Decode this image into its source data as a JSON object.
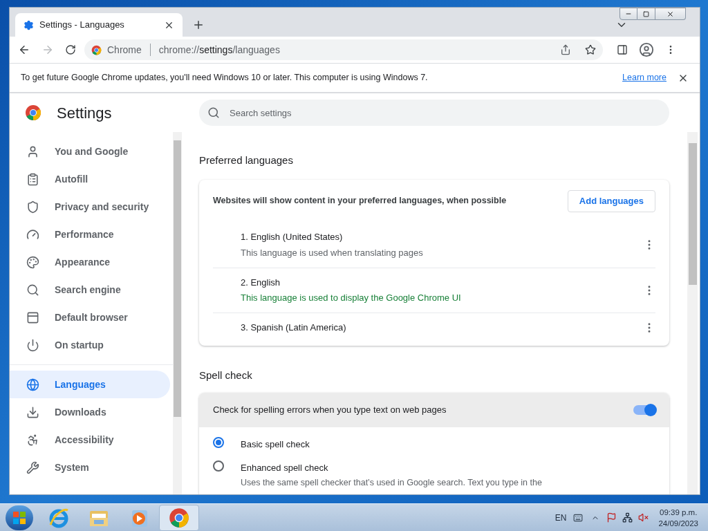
{
  "tab": {
    "title": "Settings - Languages",
    "selected": true
  },
  "toolbar": {
    "site_chip": "Chrome",
    "url": {
      "scheme": "chrome://",
      "host": "settings",
      "path": "/languages"
    }
  },
  "infobar": {
    "message": "To get future Google Chrome updates, you'll need Windows 10 or later. This computer is using Windows 7.",
    "link": "Learn more"
  },
  "header": {
    "title": "Settings",
    "search_placeholder": "Search settings"
  },
  "sidebar": {
    "groups": [
      [
        {
          "label": "You and Google",
          "selected": false
        },
        {
          "label": "Autofill",
          "selected": false
        },
        {
          "label": "Privacy and security",
          "selected": false
        },
        {
          "label": "Performance",
          "selected": false
        },
        {
          "label": "Appearance",
          "selected": false
        },
        {
          "label": "Search engine",
          "selected": false
        },
        {
          "label": "Default browser",
          "selected": false
        },
        {
          "label": "On startup",
          "selected": false
        }
      ],
      [
        {
          "label": "Languages",
          "selected": true
        },
        {
          "label": "Downloads",
          "selected": false
        },
        {
          "label": "Accessibility",
          "selected": false
        },
        {
          "label": "System",
          "selected": false
        }
      ]
    ]
  },
  "preferred_languages": {
    "heading": "Preferred languages",
    "description": "Websites will show content in your preferred languages, when possible",
    "add_button": "Add languages",
    "languages": [
      {
        "name": "1. English (United States)",
        "note": "This language is used when translating pages",
        "highlighted": false
      },
      {
        "name": "2. English",
        "note": "This language is used to display the Google Chrome UI",
        "highlighted": true
      },
      {
        "name": "3. Spanish (Latin America)"
      }
    ]
  },
  "spell_check": {
    "heading": "Spell check",
    "toggle": {
      "label": "Check for spelling errors when you type text on web pages",
      "on": true
    },
    "options": [
      {
        "label": "Basic spell check",
        "selected": true
      },
      {
        "label": "Enhanced spell check",
        "selected": false,
        "description": "Uses the same spell checker that’s used in Google search. Text you type in the"
      }
    ]
  },
  "taskbar": {
    "apps": [
      {
        "selected": false
      },
      {
        "selected": false
      },
      {
        "selected": false
      },
      {
        "selected": true
      }
    ],
    "tray": {
      "language": "EN",
      "time": "09:39 p.m.",
      "date": "24/09/2023"
    }
  }
}
